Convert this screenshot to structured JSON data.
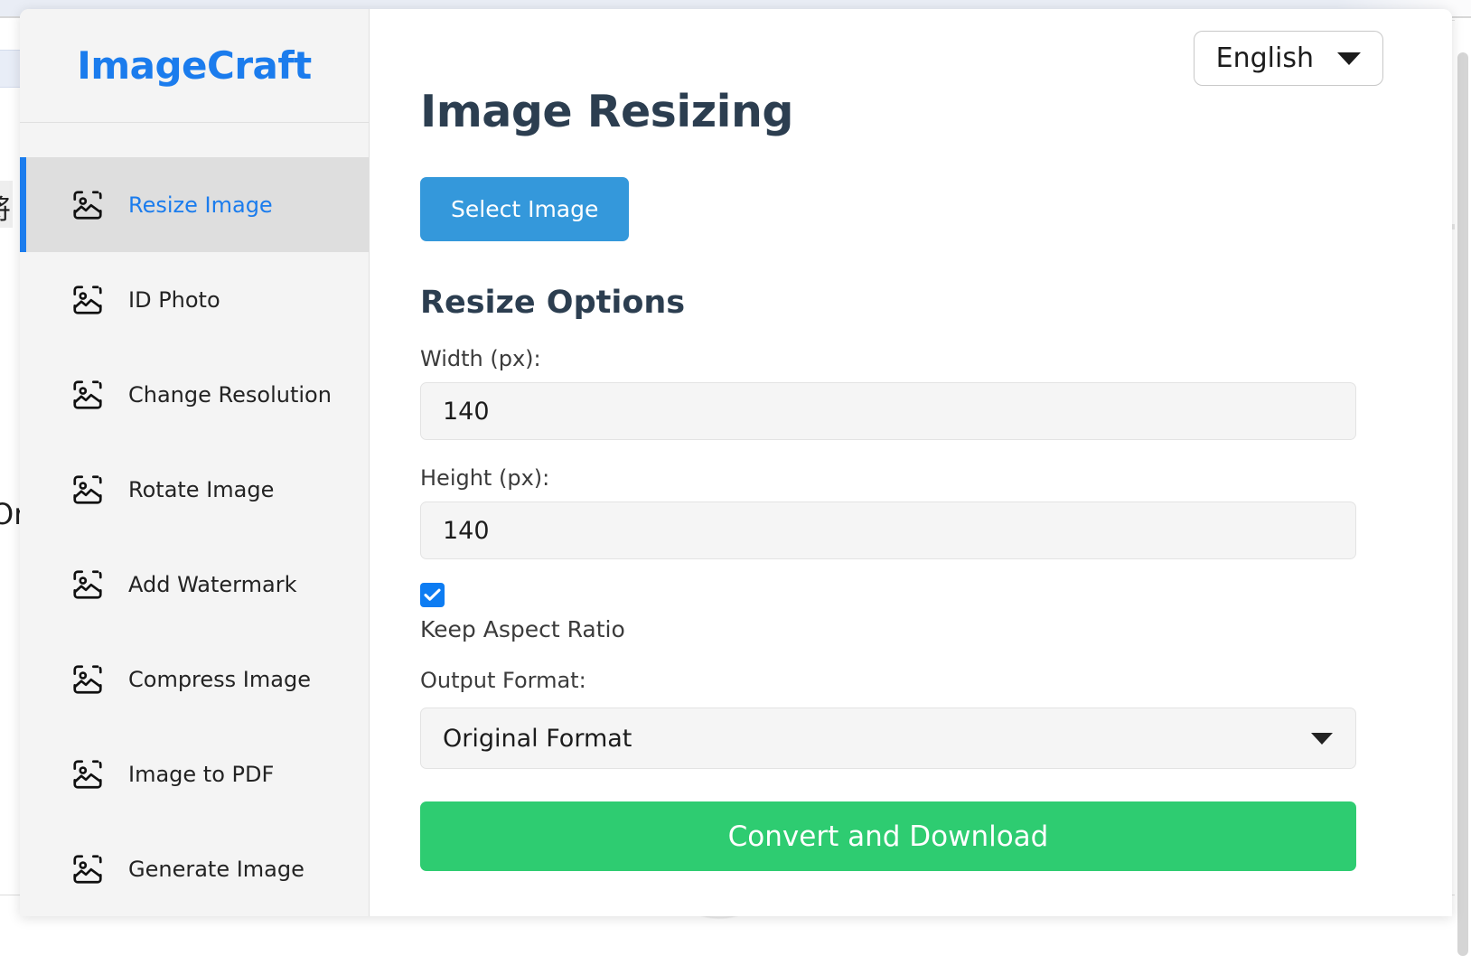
{
  "brand": {
    "name": "ImageCraft"
  },
  "sidebar": {
    "items": [
      {
        "label": "Resize Image",
        "icon": "image-icon",
        "active": true
      },
      {
        "label": "ID Photo",
        "icon": "image-icon",
        "active": false
      },
      {
        "label": "Change Resolution",
        "icon": "image-icon",
        "active": false
      },
      {
        "label": "Rotate Image",
        "icon": "image-icon",
        "active": false
      },
      {
        "label": "Add Watermark",
        "icon": "image-icon",
        "active": false
      },
      {
        "label": "Compress Image",
        "icon": "image-icon",
        "active": false
      },
      {
        "label": "Image to PDF",
        "icon": "image-icon",
        "active": false
      },
      {
        "label": "Generate Image",
        "icon": "image-icon",
        "active": false
      }
    ]
  },
  "header": {
    "language": "English",
    "language_caret_icon": "chevron-down-icon"
  },
  "main": {
    "title": "Image Resizing",
    "select_image_label": "Select Image",
    "section_title": "Resize Options",
    "width_label": "Width (px):",
    "width_value": "140",
    "height_label": "Height (px):",
    "height_value": "140",
    "keep_aspect_label": "Keep Aspect Ratio",
    "keep_aspect_checked": true,
    "output_format_label": "Output Format:",
    "output_format_value": "Original Format",
    "output_format_caret_icon": "chevron-down-icon",
    "convert_label": "Convert and Download"
  },
  "background": {
    "fragment_cjk": "将",
    "fragment_or": "Or"
  },
  "colors": {
    "brand_blue": "#1b7ced",
    "title_navy": "#2c3e50",
    "primary_button": "#3498db",
    "success_button": "#2ecc71",
    "checkbox_blue": "#0d7cf2",
    "sidebar_bg": "#f4f4f4",
    "active_item_bg": "#dedede"
  }
}
